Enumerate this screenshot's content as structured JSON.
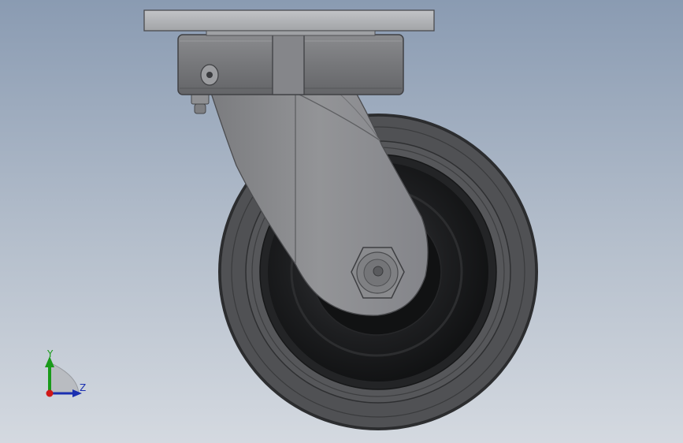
{
  "viewport": {
    "background_top": "#8a9bb2",
    "background_bottom": "#d4d9e0"
  },
  "model": {
    "icon": "caster-wheel-model",
    "colors": {
      "tire": "#4e4f52",
      "tire_edge": "#2b2c2e",
      "hub": "#1b1c1e",
      "fork": "#8c8d90",
      "plate": "#b1b3b6",
      "swivel_ring": "#7c7d80"
    }
  },
  "triad": {
    "y_label": "Y",
    "z_label": "Z",
    "colors": {
      "y_axis": "#1a9a1a",
      "z_axis": "#1a2fb0",
      "x_origin": "#d01818"
    }
  }
}
